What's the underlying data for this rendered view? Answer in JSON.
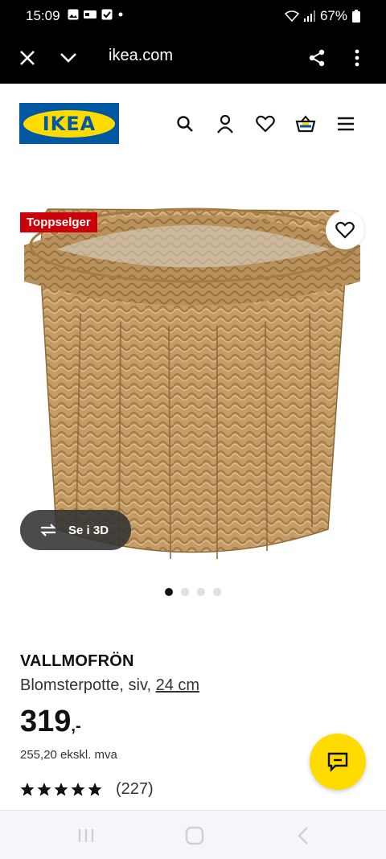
{
  "status_bar": {
    "time": "15:09",
    "battery": "67%"
  },
  "browser": {
    "url": "ikea.com"
  },
  "header": {
    "logo_text": "IKEA"
  },
  "product": {
    "badge": "Toppselger",
    "view_3d_label": "Se i 3D",
    "name": "VALLMOFRÖN",
    "description": "Blomsterpotte, siv, ",
    "size": "24 cm",
    "price": "319",
    "price_suffix": ",-",
    "price_ex_vat": "255,20 ekskl. mva",
    "rating_stars": 5,
    "review_count": "(227)",
    "image_count": 4,
    "active_image": 1
  },
  "colors": {
    "ikea_blue": "#0058a3",
    "ikea_yellow": "#ffdb00",
    "badge_red": "#cc0008"
  }
}
